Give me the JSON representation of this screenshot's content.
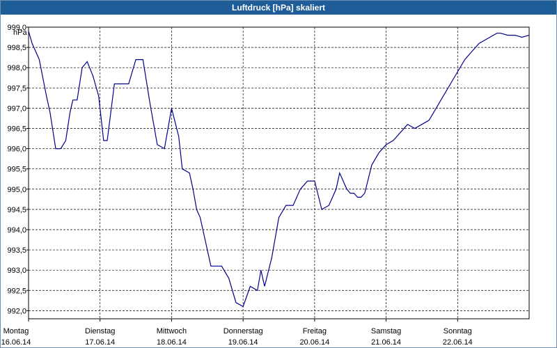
{
  "window": {
    "title": "Luftdruck [hPa] skaliert"
  },
  "chart_data": {
    "type": "line",
    "title": "Luftdruck [hPa] skaliert",
    "ylabel": "hPa",
    "xlabel": "",
    "ylim": [
      991.8,
      999.0
    ],
    "xlim": [
      0,
      7
    ],
    "grid": true,
    "yticks": [
      992.0,
      992.5,
      993.0,
      993.5,
      994.0,
      994.5,
      995.0,
      995.5,
      996.0,
      996.5,
      997.0,
      997.5,
      998.0,
      998.5,
      999.0
    ],
    "ytick_labels": [
      "992,0",
      "992,5",
      "993,0",
      "993,5",
      "994,0",
      "994,5",
      "995,0",
      "995,5",
      "996,0",
      "996,5",
      "997,0",
      "997,5",
      "998,0",
      "998,5",
      "999,0"
    ],
    "xticks": [
      {
        "day": "Montag",
        "date": "16.06.14"
      },
      {
        "day": "Dienstag",
        "date": "17.06.14"
      },
      {
        "day": "Mittwoch",
        "date": "18.06.14"
      },
      {
        "day": "Donnerstag",
        "date": "19.06.14"
      },
      {
        "day": "Freitag",
        "date": "20.06.14"
      },
      {
        "day": "Samstag",
        "date": "21.06.14"
      },
      {
        "day": "Sonntag",
        "date": "22.06.14"
      }
    ],
    "series": [
      {
        "color": "#00008b",
        "x": [
          0.0,
          0.05,
          0.15,
          0.25,
          0.3,
          0.38,
          0.45,
          0.52,
          0.58,
          0.62,
          0.68,
          0.75,
          0.82,
          0.9,
          0.98,
          1.05,
          1.1,
          1.2,
          1.3,
          1.4,
          1.5,
          1.6,
          1.7,
          1.8,
          1.9,
          2.0,
          2.1,
          2.15,
          2.25,
          2.3,
          2.35,
          2.4,
          2.5,
          2.55,
          2.6,
          2.7,
          2.8,
          2.9,
          3.0,
          3.1,
          3.2,
          3.25,
          3.3,
          3.4,
          3.5,
          3.6,
          3.7,
          3.8,
          3.9,
          4.0,
          4.1,
          4.2,
          4.3,
          4.35,
          4.45,
          4.5,
          4.55,
          4.6,
          4.65,
          4.7,
          4.8,
          4.9,
          5.0,
          5.1,
          5.2,
          5.3,
          5.4,
          5.5,
          5.6,
          5.7,
          5.8,
          5.9,
          6.0,
          6.1,
          6.2,
          6.3,
          6.4,
          6.5,
          6.55,
          6.6,
          6.7,
          6.8,
          6.9,
          7.0
        ],
        "y": [
          998.9,
          998.6,
          998.2,
          997.3,
          996.9,
          996.0,
          996.0,
          996.2,
          996.9,
          997.2,
          997.2,
          998.0,
          998.15,
          997.8,
          997.3,
          996.2,
          996.2,
          997.6,
          997.6,
          997.6,
          998.2,
          998.2,
          997.1,
          996.1,
          996.0,
          997.0,
          996.3,
          995.5,
          995.4,
          995.0,
          994.5,
          994.3,
          993.5,
          993.1,
          993.1,
          993.1,
          992.8,
          992.2,
          992.1,
          992.6,
          992.5,
          993.0,
          992.6,
          993.3,
          994.3,
          994.6,
          994.6,
          995.0,
          995.2,
          995.2,
          994.5,
          994.6,
          995.0,
          995.4,
          995.0,
          994.9,
          994.9,
          994.8,
          994.8,
          994.9,
          995.6,
          995.9,
          996.1,
          996.2,
          996.4,
          996.6,
          996.5,
          996.6,
          996.7,
          997.0,
          997.3,
          997.6,
          997.9,
          998.2,
          998.4,
          998.6,
          998.7,
          998.8,
          998.85,
          998.85,
          998.8,
          998.8,
          998.75,
          998.8
        ]
      }
    ]
  }
}
